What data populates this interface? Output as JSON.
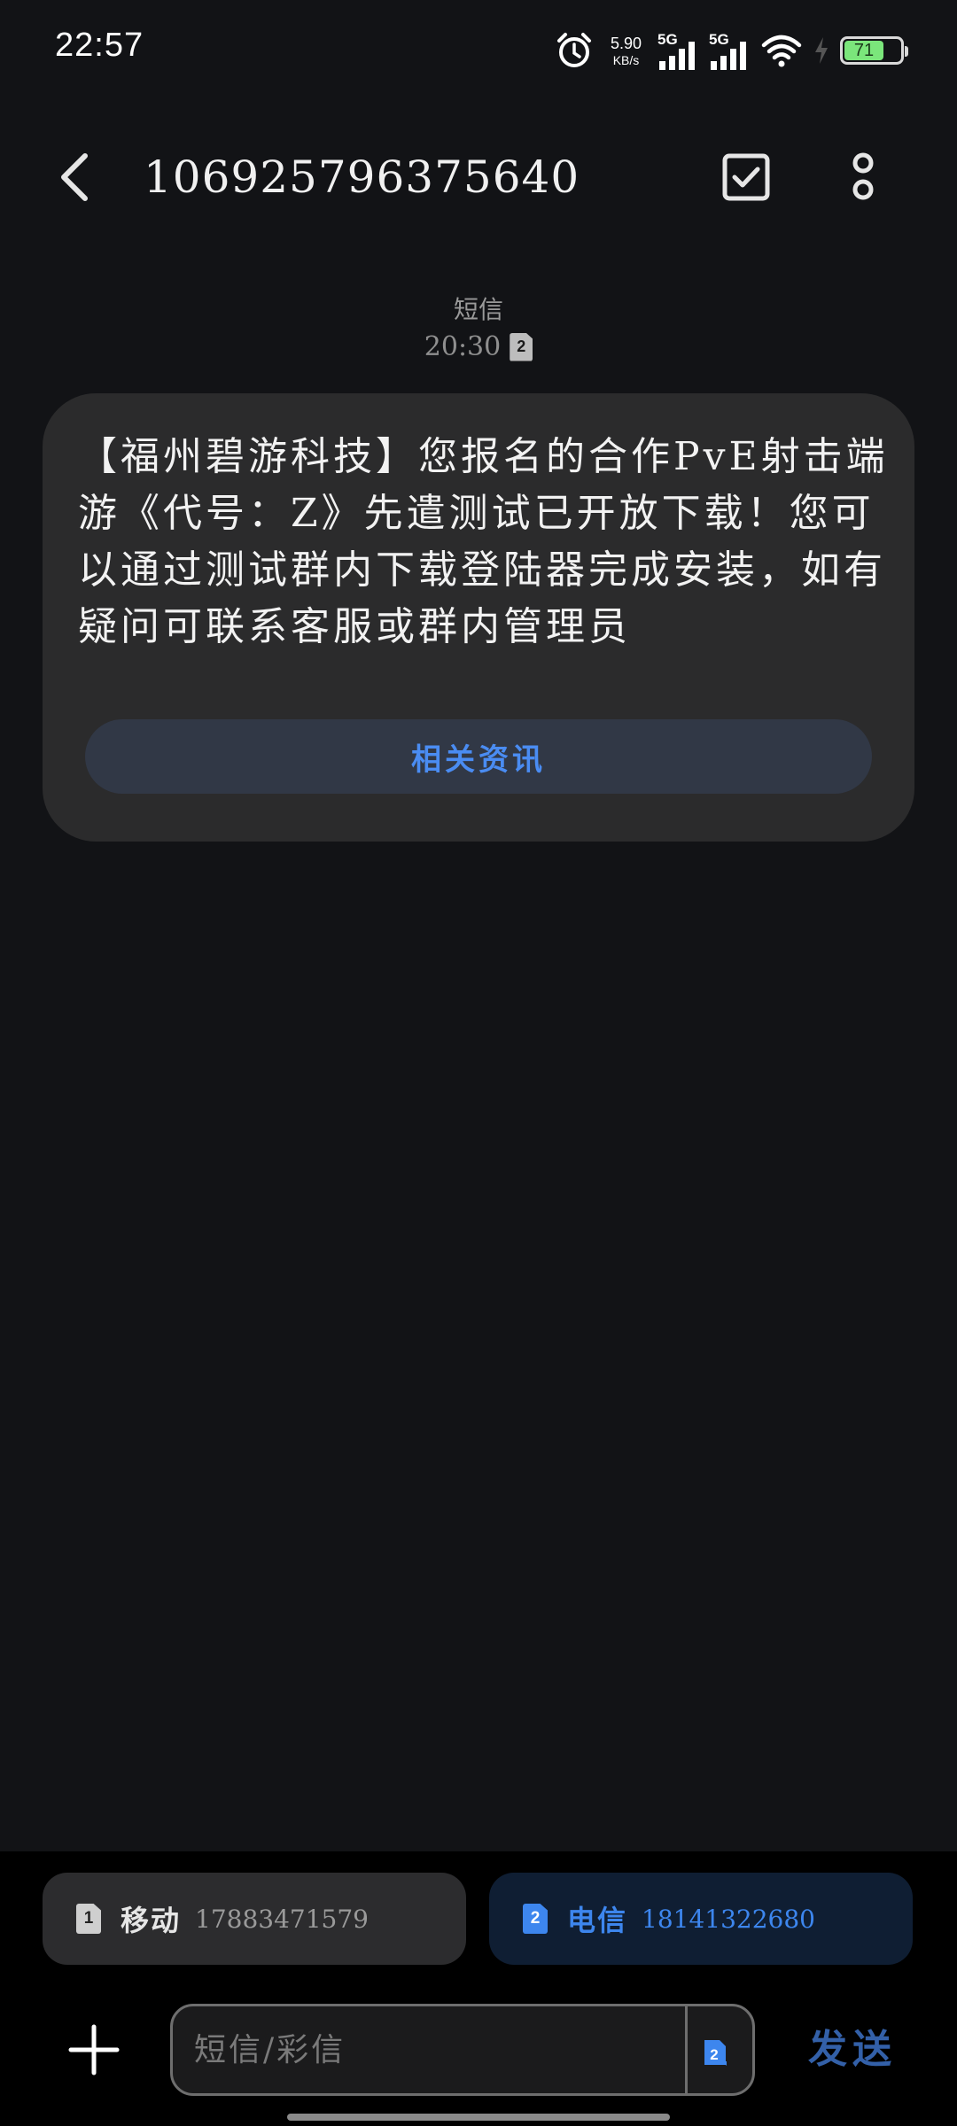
{
  "status_bar": {
    "time": "22:57",
    "net_speed_value": "5.90",
    "net_speed_unit": "KB/s",
    "sim1_network": "5G",
    "sim2_network": "5G",
    "battery_level": "71",
    "icons": [
      "alarm-icon",
      "signal-icon",
      "wifi-icon",
      "charging-bolt-icon",
      "battery-icon"
    ]
  },
  "header": {
    "title": "106925796375640",
    "icons": [
      "back-arrow-icon",
      "multi-select-checkbox-icon",
      "more-options-icon"
    ]
  },
  "thread": {
    "message_type": "短信",
    "timestamp": "20:30",
    "sim_badge": "2"
  },
  "message": {
    "text": "【福州碧游科技】您报名的合作PvE射击端游《代号：Z》先遣测试已开放下载！您可以通过测试群内下载登陆器完成安装，如有疑问可联系客服或群内管理员",
    "action_label": "相关资讯"
  },
  "sim_selector": {
    "sim1": {
      "slot": "1",
      "carrier": "移动",
      "number": "17883471579"
    },
    "sim2": {
      "slot": "2",
      "carrier": "电信",
      "number": "18141322680"
    },
    "selected": "sim2",
    "colors": {
      "accent": "#3d86ee",
      "selected_bg": "#0f1e33"
    }
  },
  "compose": {
    "placeholder": "短信/彩信",
    "value": "",
    "sim_slot": "2",
    "send_label": "发送"
  }
}
